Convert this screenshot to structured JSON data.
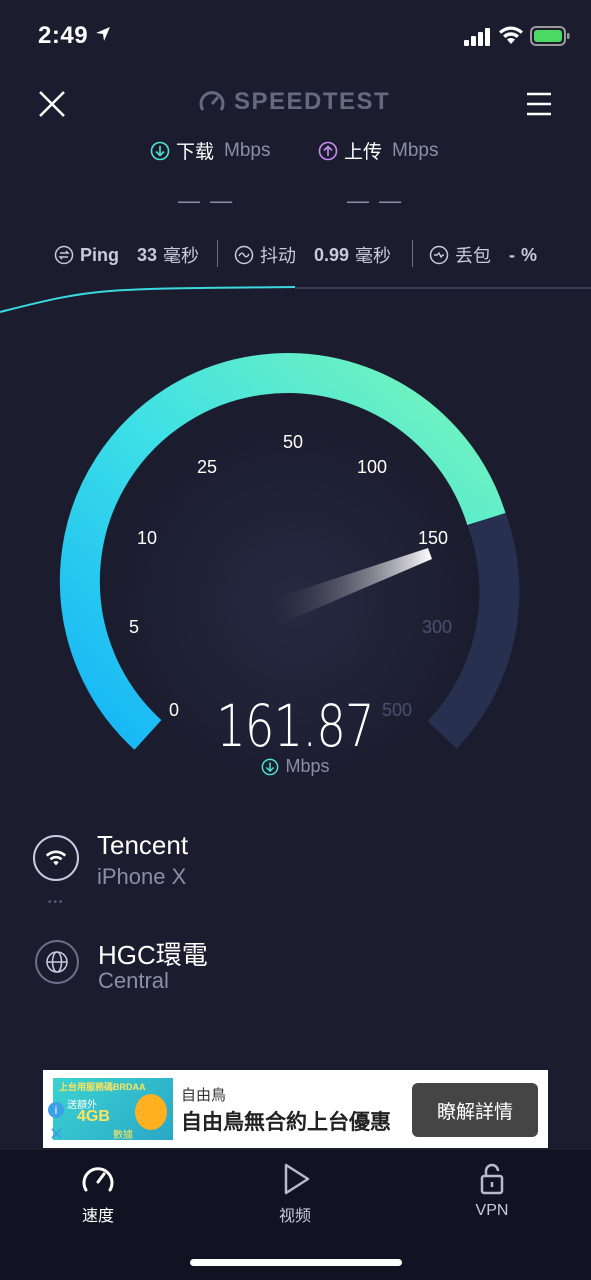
{
  "status_bar": {
    "time": "2:49"
  },
  "header": {
    "logo_text": "SPEEDTEST"
  },
  "download": {
    "label": "下载",
    "unit": "Mbps",
    "value": "— —"
  },
  "upload": {
    "label": "上传",
    "unit": "Mbps",
    "value": "— —"
  },
  "metrics": {
    "ping": {
      "label": "Ping",
      "value": "33",
      "unit": "毫秒"
    },
    "jitter": {
      "label": "抖动",
      "value": "0.99",
      "unit": "毫秒"
    },
    "loss": {
      "label": "丢包",
      "value": "-",
      "unit": "%"
    }
  },
  "gauge": {
    "ticks": [
      "0",
      "5",
      "10",
      "25",
      "50",
      "100",
      "150",
      "300",
      "500"
    ],
    "reading": "161.87",
    "unit": "Mbps",
    "colors": {
      "active_start": "#19b6f7",
      "active_end": "#6ff2b8",
      "inactive": "#27304f"
    }
  },
  "provider": {
    "name": "Tencent",
    "device": "iPhone X"
  },
  "server": {
    "name": "HGC環電",
    "location": "Central"
  },
  "ad": {
    "image_text": [
      "上台用服務碼BRDAA",
      "送額外",
      "4GB",
      "數據"
    ],
    "brand": "自由鳥",
    "title": "自由鳥無合約上台優惠",
    "cta": "瞭解詳情"
  },
  "tabs": [
    {
      "label": "速度",
      "icon": "speedometer-icon"
    },
    {
      "label": "视频",
      "icon": "play-icon"
    },
    {
      "label": "VPN",
      "icon": "lock-icon"
    }
  ]
}
